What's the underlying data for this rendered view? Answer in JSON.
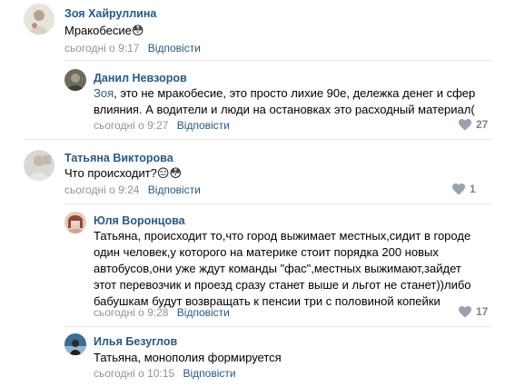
{
  "comments": [
    {
      "author": "Зоя Хайруллина",
      "text": "Мракобесие😳",
      "time": "сьогодні о 9:17",
      "reply": "Відповісти"
    },
    {
      "author": "Данил Невзоров",
      "mention": "Зоя",
      "text_after_mention": ", это не мракобесие, это просто лихие 90е, дележка денег и сфер влияния. А водители и люди на остановках это расходный материал(",
      "time": "сьогодні о 9:27",
      "reply": "Відповісти",
      "likes": "27"
    },
    {
      "author": "Татьяна Викторова",
      "text": "Что происходит?😑😳",
      "time": "сьогодні о 9:24",
      "reply": "Відповісти",
      "likes": "1"
    },
    {
      "author": "Юля Воронцова",
      "text": "Татьяна, происходит то,что город выжимает местных,сидит в городе один человек,у которого на материке стоит порядка 200 новых автобусов,они уже ждут команды \"фас\",местных выжимают,зайдет этот перевозчик и проезд сразу станет выше и льгот не станет))либо бабушкам будут возвращать к пенсии три с половиной копейки",
      "time": "сьогодні о 9:28",
      "reply": "Відповісти",
      "likes": "17"
    },
    {
      "author": "Илья Безуглов",
      "text": "Татьяна, монополия формируется",
      "time": "сьогодні о 10:15",
      "reply": "Відповісти"
    }
  ]
}
